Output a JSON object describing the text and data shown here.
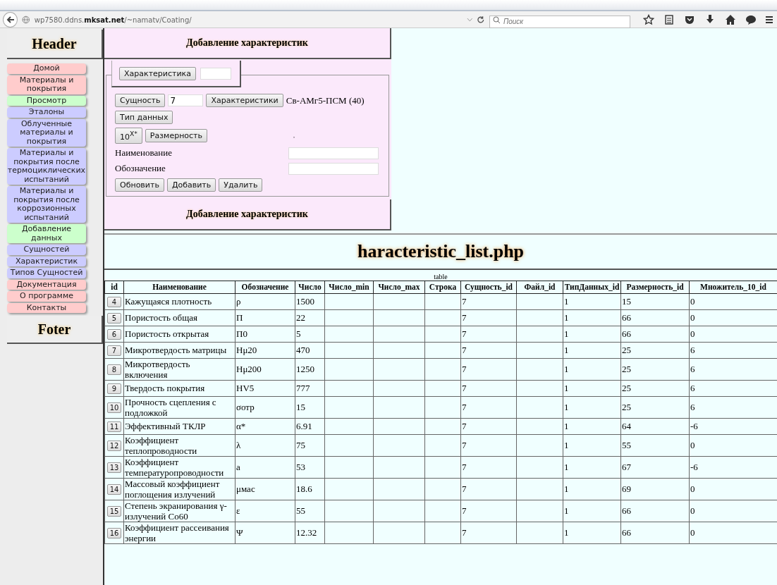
{
  "browser": {
    "url": "wp7580.ddns.**mksat.net**/~namatv/Coating/",
    "search": {
      "placeholder": "Поиск"
    }
  },
  "sidebar": {
    "header": "Header",
    "items": [
      {
        "label": "Домой",
        "color": "#ffcccc"
      },
      {
        "label": "Материалы и покрытия",
        "color": "#ffcccc"
      },
      {
        "label": "Просмотр",
        "color": "#ccffcc"
      },
      {
        "label": "Эталоны",
        "color": "#ccccff"
      },
      {
        "label": "Облученные материалы и покрытия",
        "color": "#ccccff"
      },
      {
        "label": "Материалы и покрытия после термоциклических испытаний",
        "color": "#ccccff"
      },
      {
        "label": "Материалы и покрытия после коррозионных испытаний",
        "color": "#ccccff"
      },
      {
        "label": "Добавление данных",
        "color": "#ccffcc"
      },
      {
        "label": "Сущностей",
        "color": "#ccccff"
      },
      {
        "label": "Характеристик",
        "color": "#ccccff"
      },
      {
        "label": "Типов Сущностей",
        "color": "#ccccff"
      },
      {
        "label": "Документация",
        "color": "#ffcccc"
      },
      {
        "label": "О программе",
        "color": "#ffcccc"
      },
      {
        "label": "Контакты",
        "color": "#ffcccc"
      }
    ],
    "footer": "Foter"
  },
  "form": {
    "title": "Добавление характеристик",
    "characteristic_button": "Характеристика",
    "entity_button": "Сущность",
    "entity_value": "7",
    "characteristics_button": "Характеристики",
    "entity_name": "Св-АМг5-ПСМ (40)",
    "data_type_button": "Тип данных",
    "power_button": "10$^{X*}$",
    "dimension_button": "Размерность",
    "dimension_text": ",",
    "fields": [
      {
        "label": "Наименование"
      },
      {
        "label": "Обозначение"
      }
    ],
    "buttons": [
      "Обновить",
      "Добавить",
      "Удалить"
    ],
    "footer_title": "Добавление характеристик"
  },
  "page_title": "haracteristic_list.php",
  "table": {
    "caption": "table",
    "columns": [
      "id",
      "Наименование",
      "Обозначение",
      "Число",
      "Число_min",
      "Число_max",
      "Строка",
      "Сущность_id",
      "Файл_id",
      "ТипДанных_id",
      "Размерность_id",
      "Множитель_10_id"
    ],
    "rows": [
      {
        "id": "4",
        "name": "Кажущаяся плотность",
        "symbol": "ρ",
        "number": "1500",
        "entity_id": "7",
        "type_id": "1",
        "dimension_id": "15",
        "multiplier_id": "0"
      },
      {
        "id": "5",
        "name": "Пористость общая",
        "symbol": "П",
        "number": "22",
        "entity_id": "7",
        "type_id": "1",
        "dimension_id": "66",
        "multiplier_id": "0"
      },
      {
        "id": "6",
        "name": "Пористость открытая",
        "symbol": "П0",
        "number": "5",
        "entity_id": "7",
        "type_id": "1",
        "dimension_id": "66",
        "multiplier_id": "0"
      },
      {
        "id": "7",
        "name": "Микротвердость матрицы",
        "symbol": "Hμ20",
        "number": "470",
        "entity_id": "7",
        "type_id": "1",
        "dimension_id": "25",
        "multiplier_id": "6"
      },
      {
        "id": "8",
        "name": "Микротвердость включения",
        "symbol": "Hμ200",
        "number": "1250",
        "entity_id": "7",
        "type_id": "1",
        "dimension_id": "25",
        "multiplier_id": "6"
      },
      {
        "id": "9",
        "name": "Твердость покрытия",
        "symbol": "HV5",
        "number": "777",
        "entity_id": "7",
        "type_id": "1",
        "dimension_id": "25",
        "multiplier_id": "6"
      },
      {
        "id": "10",
        "name": "Прочность сцепления с подложкой",
        "symbol": "σотр",
        "number": "15",
        "entity_id": "7",
        "type_id": "1",
        "dimension_id": "25",
        "multiplier_id": "6"
      },
      {
        "id": "11",
        "name": "Эффективный ТКЛР",
        "symbol": "α*",
        "number": "6.91",
        "entity_id": "7",
        "type_id": "1",
        "dimension_id": "64",
        "multiplier_id": "-6"
      },
      {
        "id": "12",
        "name": "Коэффициент теплопроводности",
        "symbol": "λ",
        "number": "75",
        "entity_id": "7",
        "type_id": "1",
        "dimension_id": "55",
        "multiplier_id": "0"
      },
      {
        "id": "13",
        "name": "Коэффициент температуропроводности",
        "symbol": "a",
        "number": "53",
        "entity_id": "7",
        "type_id": "1",
        "dimension_id": "67",
        "multiplier_id": "-6"
      },
      {
        "id": "14",
        "name": "Массовый коэффициент поглощения излучений",
        "symbol": "μмас",
        "number": "18.6",
        "entity_id": "7",
        "type_id": "1",
        "dimension_id": "69",
        "multiplier_id": "0"
      },
      {
        "id": "15",
        "name": "Степень экранирования γ-излучений Co60",
        "symbol": "ε",
        "number": "55",
        "entity_id": "7",
        "type_id": "1",
        "dimension_id": "66",
        "multiplier_id": "0"
      },
      {
        "id": "16",
        "name": "Коэффициент рассеивания энергии",
        "symbol": "Ψ",
        "number": "12.32",
        "entity_id": "7",
        "type_id": "1",
        "dimension_id": "66",
        "multiplier_id": "0"
      }
    ]
  }
}
